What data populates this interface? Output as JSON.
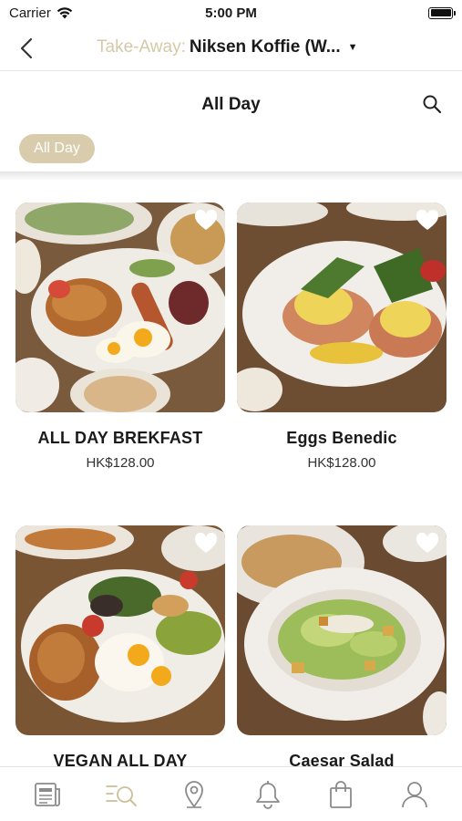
{
  "status_bar": {
    "carrier": "Carrier",
    "time": "5:00 PM"
  },
  "nav": {
    "prefix": "Take-Away:",
    "store": "Niksen Koffie (W...",
    "caret": "▼"
  },
  "category": {
    "title": "All Day"
  },
  "filter_chips": [
    {
      "label": "All Day",
      "selected": true
    }
  ],
  "products": [
    {
      "name": "ALL DAY BREKFAST",
      "price": "HK$128.00"
    },
    {
      "name": "Eggs Benedic",
      "price": "HK$128.00"
    },
    {
      "name": "VEGAN ALL DAY",
      "price": ""
    },
    {
      "name": "Caesar Salad",
      "price": ""
    }
  ],
  "tabs": [
    {
      "icon": "news-icon",
      "active": false
    },
    {
      "icon": "menu-search-icon",
      "active": true
    },
    {
      "icon": "location-pin-icon",
      "active": false
    },
    {
      "icon": "bell-icon",
      "active": false
    },
    {
      "icon": "shopping-bag-icon",
      "active": false
    },
    {
      "icon": "profile-icon",
      "active": false
    }
  ],
  "colors": {
    "accent": "#d8ccad",
    "accent_text": "#d6c9a8",
    "icon_gray": "#8a8a8a",
    "active_tab": "#cdbf98"
  }
}
